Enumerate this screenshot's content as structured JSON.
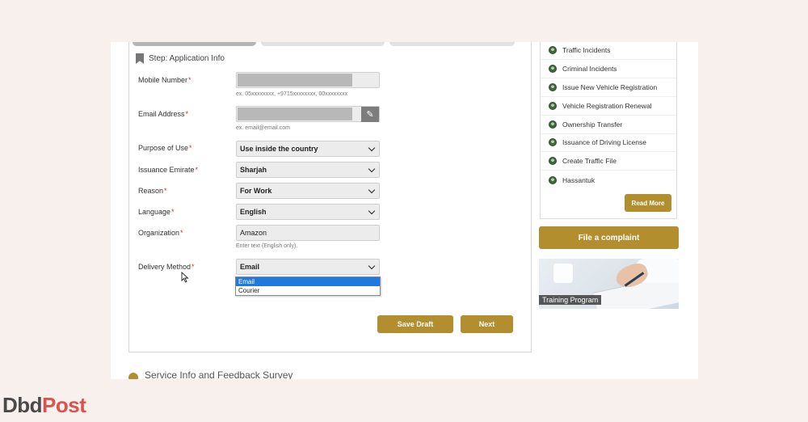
{
  "form": {
    "step_title": "Step: Application Info",
    "mobile": {
      "label": "Mobile Number",
      "hint": "ex. 05xxxxxxxx, +9715xxxxxxxx, 00xxxxxxxx"
    },
    "email": {
      "label": "Email Address",
      "hint": "ex. email@email.com"
    },
    "purpose": {
      "label": "Purpose of Use",
      "value": "Use inside the country"
    },
    "emirate": {
      "label": "Issuance Emirate",
      "value": "Sharjah"
    },
    "reason": {
      "label": "Reason",
      "value": "For Work"
    },
    "language": {
      "label": "Language",
      "value": "English"
    },
    "organization": {
      "label": "Organization",
      "value": "Amazon",
      "hint": "Enter text (English only)."
    },
    "delivery": {
      "label": "Delivery Method",
      "value": "Email",
      "options": [
        "Email",
        "Courier"
      ]
    },
    "required_mark": "*",
    "save_draft": "Save Draft",
    "next": "Next"
  },
  "sidebar": {
    "items": [
      "Traffic Incidents",
      "Criminal Incidents",
      "Issue New Vehicle Registration",
      "Vehicle Registration Renewal",
      "Ownership Transfer",
      "Issuance of Driving License",
      "Create Traffic File",
      "Hassantuk"
    ],
    "read_more": "Read More",
    "complaint": "File a complaint",
    "training_label": "Training Program"
  },
  "footer": {
    "section_heading": "Service Info and Feedback Survey",
    "logo_part1": "Dbd",
    "logo_part2": "Post"
  },
  "colors": {
    "accent_gold": "#b38e2e",
    "select_highlight": "#1e7ae0",
    "required": "#c0392b"
  },
  "icons": {
    "step": "bookmark-icon",
    "edit": "pencil-icon",
    "dropdown": "chevron-down-icon",
    "sidebar_bullet": "emblem-icon"
  }
}
